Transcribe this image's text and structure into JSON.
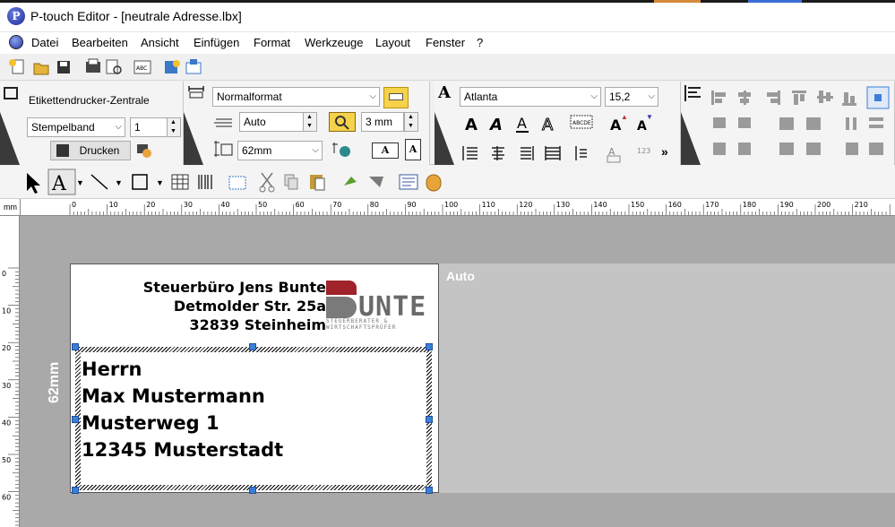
{
  "window": {
    "title": "P-touch Editor - [neutrale Adresse.lbx]"
  },
  "menu": {
    "items": [
      {
        "id": "datei",
        "label": "Datei"
      },
      {
        "id": "bearbeiten",
        "label": "Bearbeiten"
      },
      {
        "id": "ansicht",
        "label": "Ansicht"
      },
      {
        "id": "einfuegen",
        "label": "Einfügen"
      },
      {
        "id": "format",
        "label": "Format"
      },
      {
        "id": "werkzeuge",
        "label": "Werkzeuge"
      },
      {
        "id": "layout",
        "label": "Layout"
      },
      {
        "id": "fenster",
        "label": "Fenster"
      },
      {
        "id": "help",
        "label": "?"
      }
    ]
  },
  "printer_dock": {
    "title": "Etikettendrucker-Zentrale",
    "mode_value": "Stempelband",
    "copies_value": "1",
    "print_label": "Drucken"
  },
  "format_dock": {
    "format_value": "Normalformat",
    "length_value": "Auto",
    "margin_value": "3 mm",
    "width_value": "62mm"
  },
  "text_dock": {
    "font_value": "Atlanta",
    "size_value": "15,2",
    "more_label": "»"
  },
  "ruler": {
    "unit": "mm",
    "ticks": [
      "0",
      "10",
      "20",
      "30",
      "40",
      "50",
      "60",
      "70",
      "80",
      "90",
      "100",
      "110",
      "120",
      "130",
      "140",
      "150",
      "160",
      "170",
      "180",
      "190",
      "200",
      "210",
      "2"
    ],
    "vticks": [
      "0",
      "10",
      "20",
      "30",
      "40",
      "50",
      "60"
    ]
  },
  "canvas": {
    "auto_label": "Auto",
    "height_label": "62mm",
    "sender_lines": [
      "Steuerbüro Jens Bunte",
      "Detmolder Str. 25a",
      "32839 Steinheim"
    ],
    "logo": {
      "word": "UNTE",
      "sub_line1": "STEUERBERATER &",
      "sub_line2": "WIRTSCHAFTSPRÜFER"
    },
    "address_lines": [
      "Herrn",
      "Max Mustermann",
      "Musterweg 1",
      "12345 Musterstadt"
    ]
  },
  "colors": {
    "canvas_bg": "#a9a9a9",
    "selection_handle": "#3c7fd8",
    "logo_red": "#a0222a"
  }
}
